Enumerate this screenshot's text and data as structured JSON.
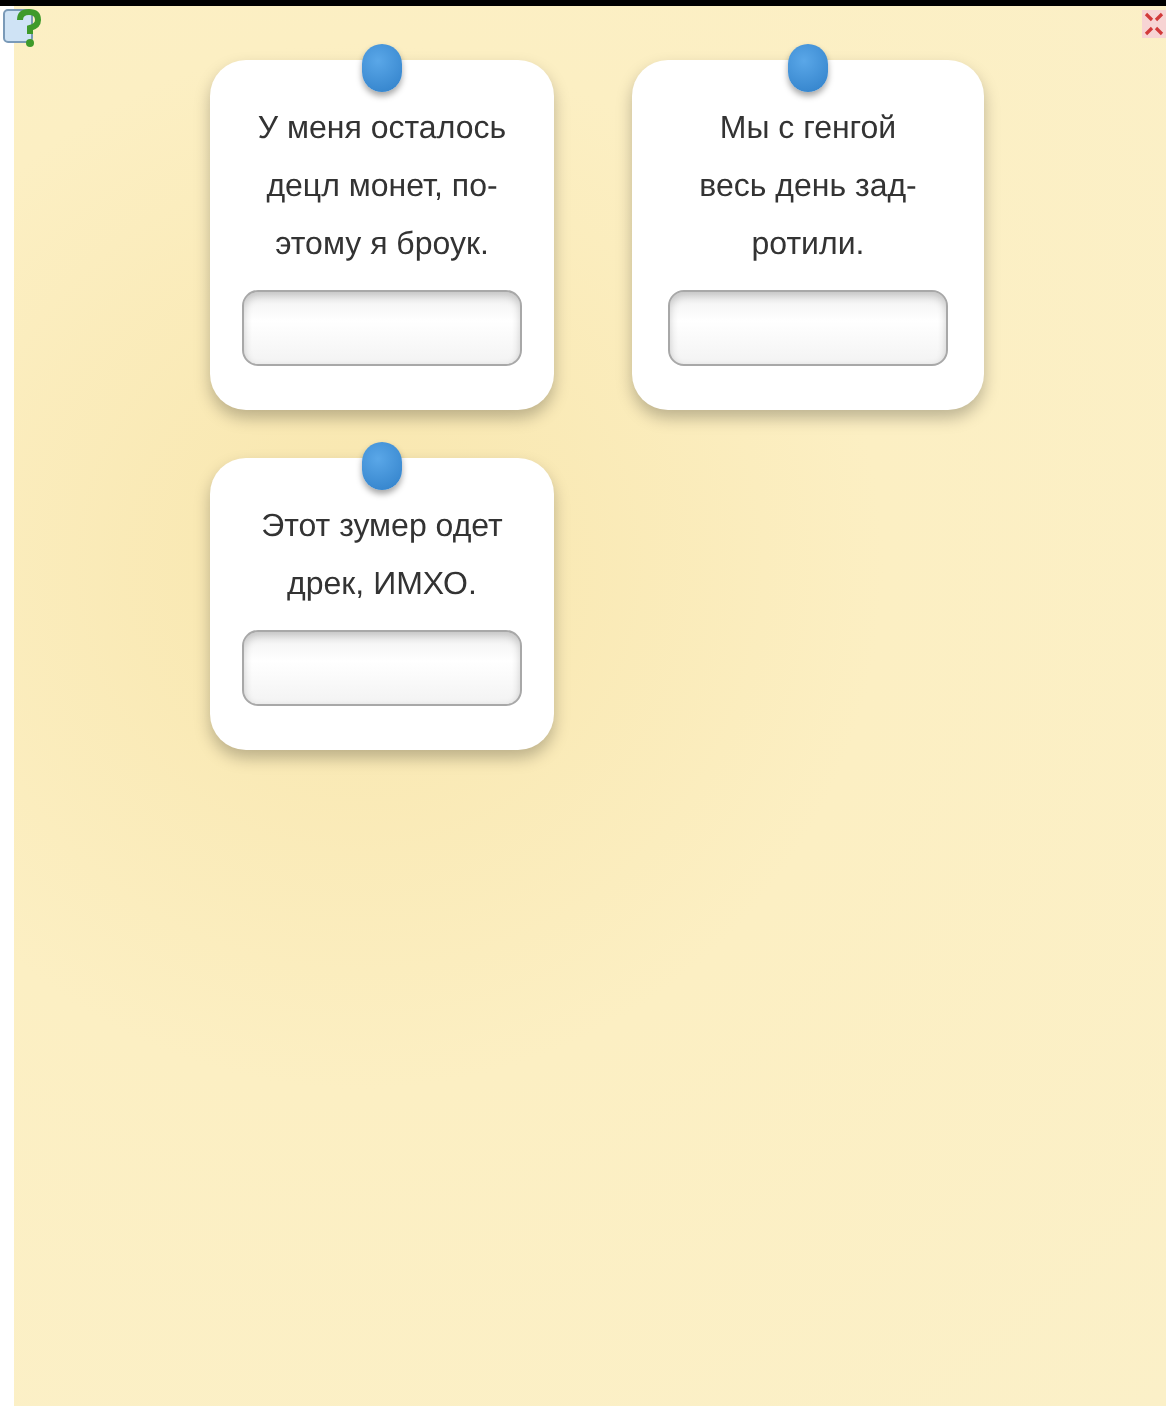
{
  "cards": [
    {
      "text": "У меня осталось\nдецл монет, по-\nэтому я броук."
    },
    {
      "text": "Мы с генгой\nвесь день зад-\nротили."
    },
    {
      "text": "Этот зумер одет\nдрек, ИМХО."
    }
  ]
}
